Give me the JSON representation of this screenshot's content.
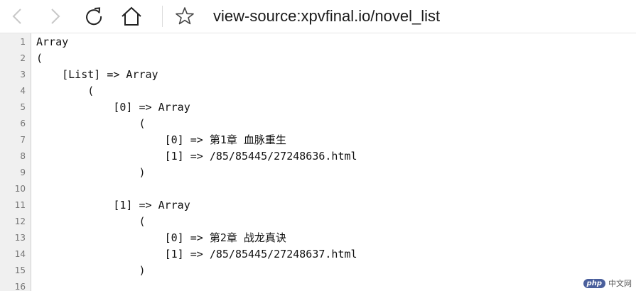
{
  "browser": {
    "url": "view-source:xpvfinal.io/novel_list",
    "icons": [
      "back-icon",
      "forward-icon",
      "reload-icon",
      "home-icon",
      "star-icon"
    ]
  },
  "source": {
    "lines": [
      {
        "num": "1",
        "text": "Array"
      },
      {
        "num": "2",
        "text": "("
      },
      {
        "num": "3",
        "text": "    [List] => Array"
      },
      {
        "num": "4",
        "text": "        ("
      },
      {
        "num": "5",
        "text": "            [0] => Array"
      },
      {
        "num": "6",
        "text": "                ("
      },
      {
        "num": "7",
        "text": "                    [0] => 第1章 血脉重生"
      },
      {
        "num": "8",
        "text": "                    [1] => /85/85445/27248636.html"
      },
      {
        "num": "9",
        "text": "                )"
      },
      {
        "num": "10",
        "text": ""
      },
      {
        "num": "11",
        "text": "            [1] => Array"
      },
      {
        "num": "12",
        "text": "                ("
      },
      {
        "num": "13",
        "text": "                    [0] => 第2章 战龙真诀"
      },
      {
        "num": "14",
        "text": "                    [1] => /85/85445/27248637.html"
      },
      {
        "num": "15",
        "text": "                )"
      },
      {
        "num": "16",
        "text": ""
      }
    ]
  },
  "watermark": {
    "logo": "php",
    "text": "中文网"
  }
}
